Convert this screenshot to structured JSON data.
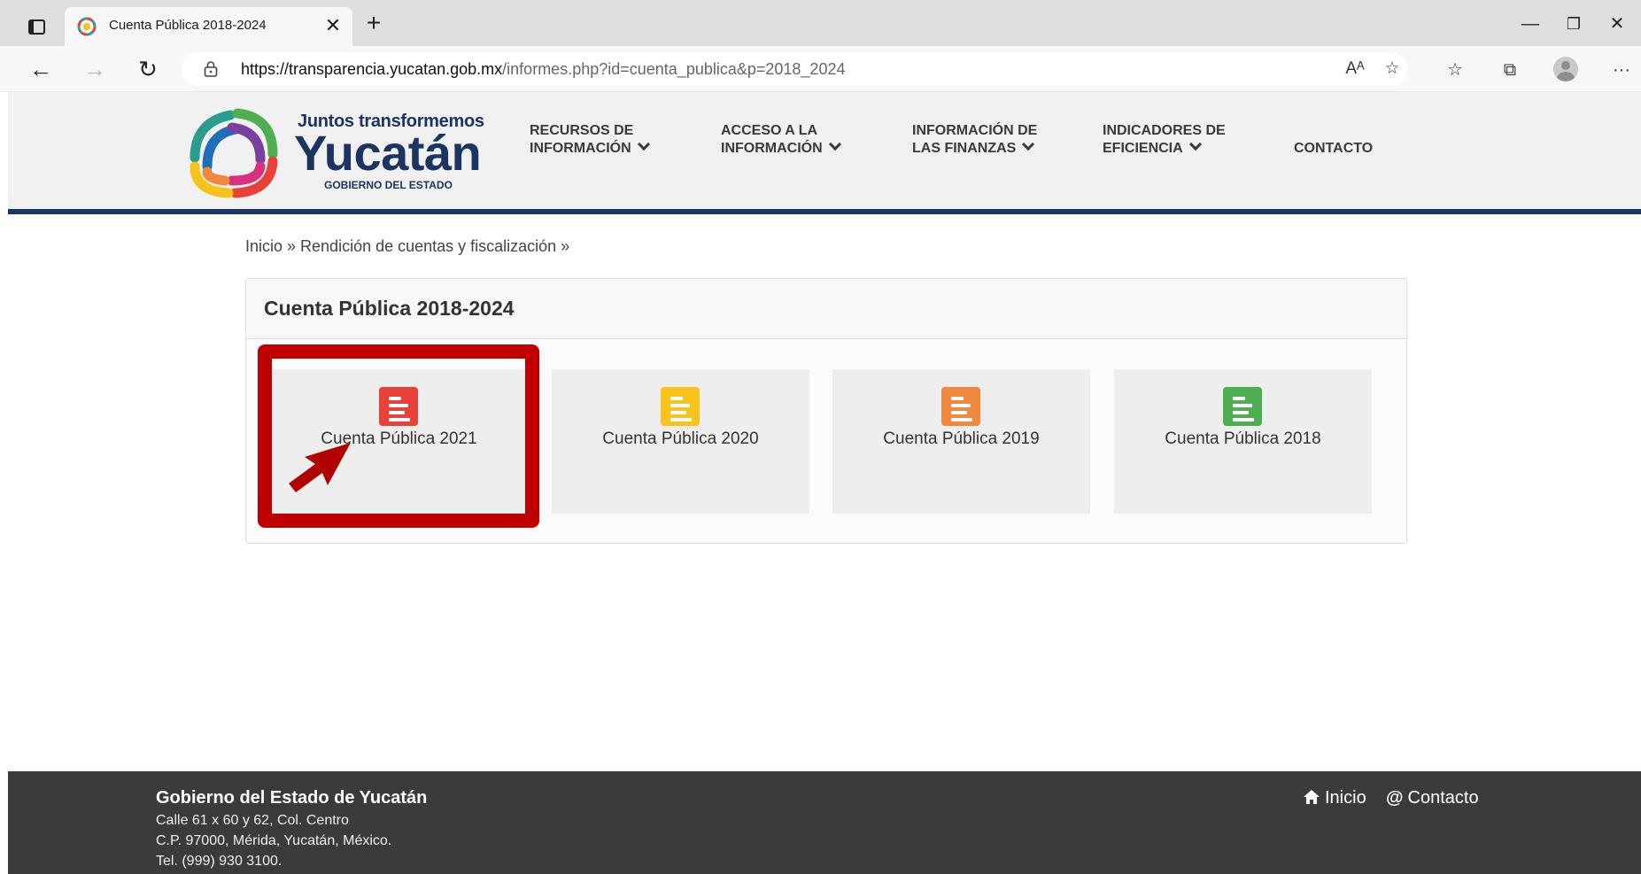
{
  "browser": {
    "tab_title": "Cuenta Pública 2018-2024",
    "tab_close": "✕",
    "new_tab": "+",
    "url_host": "https://transparencia.yucatan.gob.mx",
    "url_path": "/informes.php?id=cuenta_publica&p=2018_2024",
    "minimize": "—",
    "restore": "❐",
    "close": "✕",
    "more": "···"
  },
  "header": {
    "logo_top": "Juntos transformemos",
    "logo_main": "Yucatán",
    "logo_sub": "GOBIERNO DEL ESTADO",
    "menu": [
      {
        "line1": "RECURSOS DE",
        "line2": "INFORMACIÓN"
      },
      {
        "line1": "ACCESO A LA",
        "line2": "INFORMACIÓN"
      },
      {
        "line1": "INFORMACIÓN DE",
        "line2": "LAS FINANZAS"
      },
      {
        "line1": "INDICADORES DE",
        "line2": "EFICIENCIA"
      },
      {
        "line1": "CONTACTO"
      }
    ]
  },
  "breadcrumb": "Inicio » Rendición de cuentas y fiscalización »",
  "panel": {
    "title": "Cuenta Pública 2018-2024",
    "cards": [
      {
        "label": "Cuenta Pública 2021",
        "color": "#e8413a"
      },
      {
        "label": "Cuenta Pública 2020",
        "color": "#f7c21b"
      },
      {
        "label": "Cuenta Pública 2019",
        "color": "#f0893e"
      },
      {
        "label": "Cuenta Pública 2018",
        "color": "#4daf50"
      }
    ]
  },
  "annotation": {
    "highlight_color": "#c00000"
  },
  "footer": {
    "title": "Gobierno del Estado de Yucatán",
    "address1": "Calle 61 x 60 y 62, Col. Centro",
    "address2": "C.P. 97000, Mérida, Yucatán, México.",
    "phone": "Tel. (999) 930 3100.",
    "link_home": "Inicio",
    "link_contact": "Contacto"
  }
}
